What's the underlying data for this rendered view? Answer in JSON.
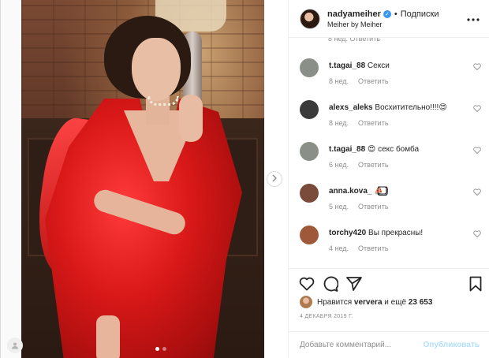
{
  "header": {
    "username": "nadyameiher",
    "separator": "•",
    "follow_label": "Подписки",
    "location": "Meiher by Meiher",
    "more_icon": "more-horizontal-icon"
  },
  "partial_comment_meta": "8 нед.   Ответить",
  "comments": [
    {
      "user": "t.tagai_88",
      "text": "Секси",
      "age": "8 нед.",
      "reply": "Ответить",
      "avatar_color": "#8a8f88"
    },
    {
      "user": "alexs_aleks",
      "text": "Восхитительно!!!!😍",
      "age": "8 нед.",
      "reply": "Ответить",
      "avatar_color": "#3a3a3a"
    },
    {
      "user": "t.tagai_88",
      "text": "😍 секс бомба",
      "age": "6 нед.",
      "reply": "Ответить",
      "avatar_color": "#8a8f88"
    },
    {
      "user": "anna.kova_",
      "text": "⛵⃣⃣⃣⃣♀",
      "age": "5 нед.",
      "reply": "Ответить",
      "avatar_color": "#7a4a3a"
    },
    {
      "user": "torchy420",
      "text": "Вы прекрасны!",
      "age": "4 нед.",
      "reply": "Ответить",
      "avatar_color": "#a0583a"
    }
  ],
  "likes": {
    "prefix": "Нравится",
    "user": "ververa",
    "middle": "и ещё",
    "count": "23 653"
  },
  "date": "4 ДЕКАБРЯ 2019 Г.",
  "add_comment": {
    "placeholder": "Добавьте комментарий...",
    "publish": "Опубликовать"
  },
  "colors": {
    "accent": "#3897f0",
    "publish_disabled": "#b2dffc",
    "muted": "#8e8e8e"
  }
}
